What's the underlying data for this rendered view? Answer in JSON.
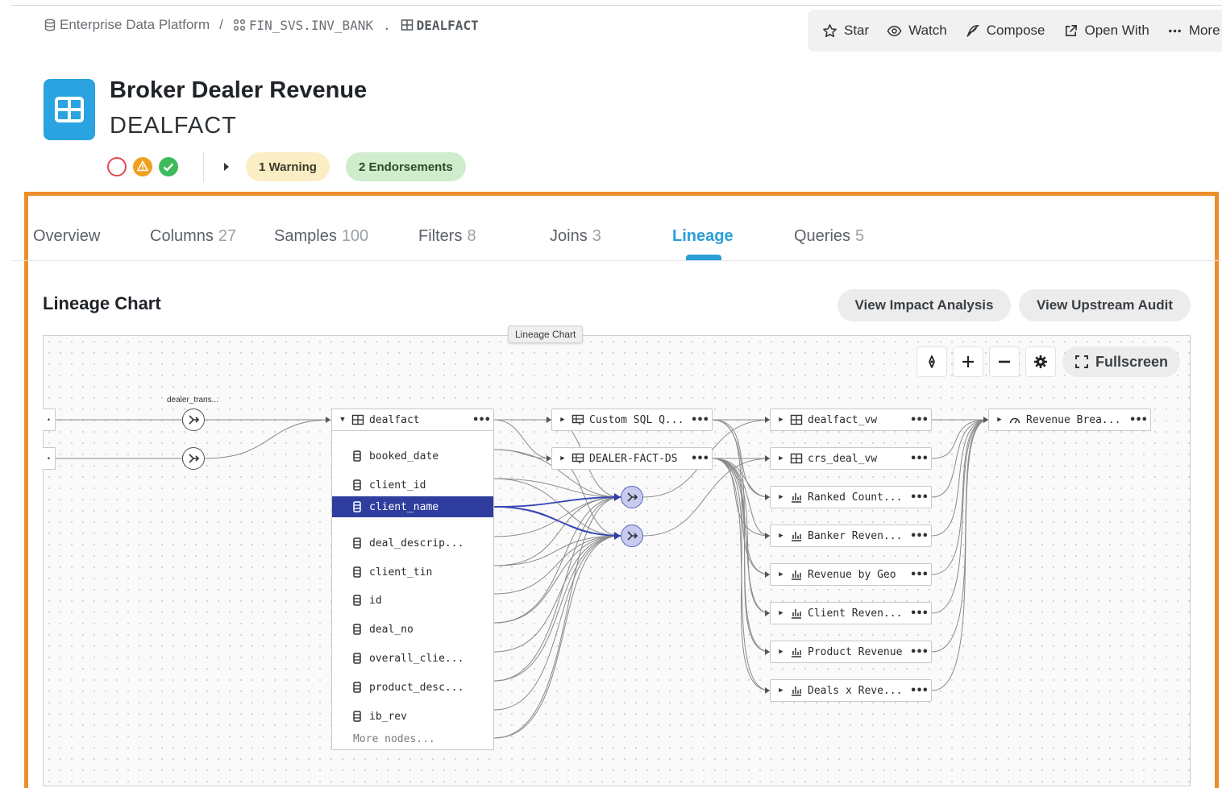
{
  "breadcrumb": {
    "platform": "Enterprise Data Platform",
    "separator": "/",
    "schema": "FIN_SVS.INV_BANK",
    "dot": ".",
    "table": "DEALFACT"
  },
  "toolbar": {
    "star": "Star",
    "watch": "Watch",
    "compose": "Compose",
    "open_with": "Open With",
    "more": "More"
  },
  "header": {
    "title": "Broker Dealer Revenue",
    "subtitle": "DEALFACT",
    "status_colors": {
      "error": "#e5484d",
      "warning": "#f0a020",
      "ok": "#3dbb5c"
    },
    "warning_pill": "1 Warning",
    "endorse_pill": "2 Endorsements"
  },
  "tabs": [
    {
      "label": "Overview",
      "count": ""
    },
    {
      "label": "Columns",
      "count": "27"
    },
    {
      "label": "Samples",
      "count": "100"
    },
    {
      "label": "Filters",
      "count": "8"
    },
    {
      "label": "Joins",
      "count": "3"
    },
    {
      "label": "Lineage",
      "count": "",
      "active": true
    },
    {
      "label": "Queries",
      "count": "5"
    }
  ],
  "lineage": {
    "section_title": "Lineage Chart",
    "impact_button": "View Impact Analysis",
    "upstream_button": "View Upstream Audit",
    "canvas_tag": "Lineage Chart",
    "fullscreen": "Fullscreen",
    "upstream_label": "dealer_trans...",
    "root_node": "dealfact",
    "columns": [
      "booked_date",
      "client_id",
      "client_name",
      "deal_descrip...",
      "client_tin",
      "id",
      "deal_no",
      "overall_clie...",
      "product_desc...",
      "ib_rev"
    ],
    "selected_column": "client_name",
    "more_nodes": "More nodes...",
    "datasources": [
      "Custom SQL Q...",
      "DEALER-FACT-DS"
    ],
    "downstream": [
      "dealfact_vw",
      "crs_deal_vw",
      "Ranked Count...",
      "Banker Reven...",
      "Revenue by Geo",
      "Client Reven...",
      "Product Revenue",
      "Deals x Reve..."
    ],
    "final_node": "Revenue Brea...",
    "accent": "#2f3e9e",
    "frame_color": "#ee8e2a"
  }
}
